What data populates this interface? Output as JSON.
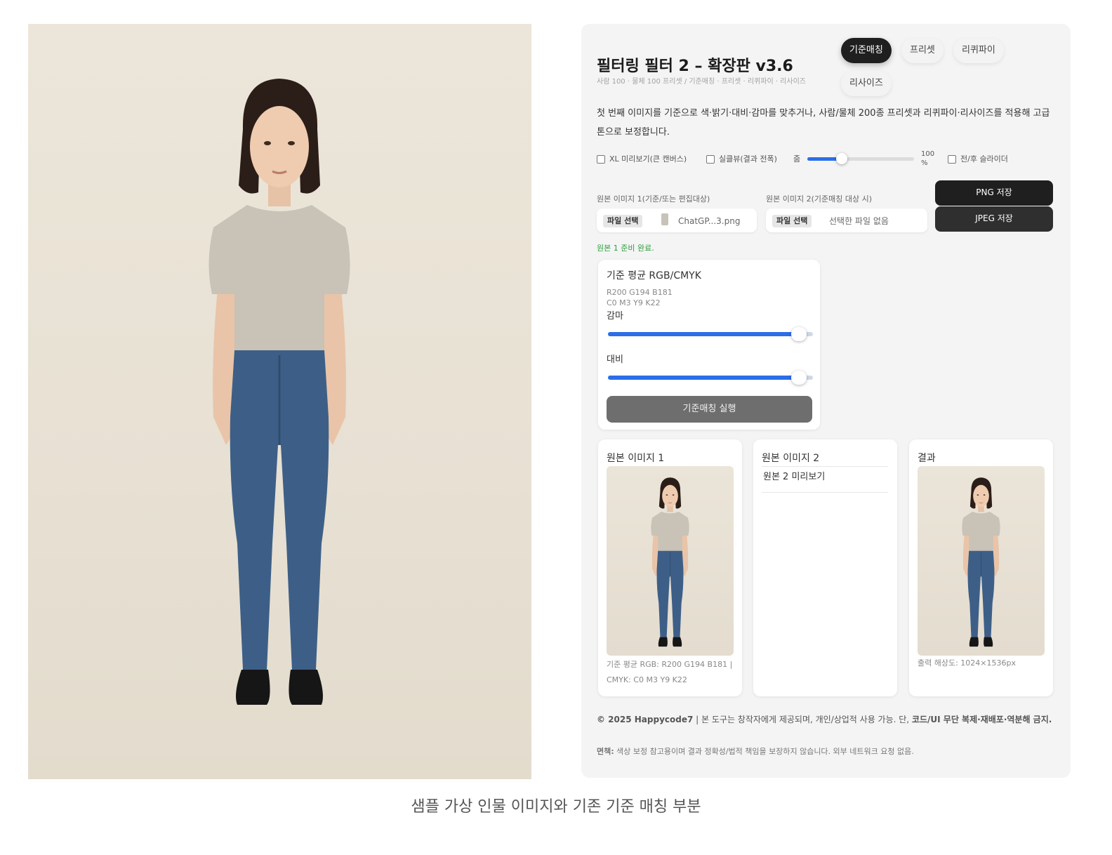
{
  "app": {
    "title": "필터링 필터 2 – 확장판 v3.6",
    "subtitle": "사람 100 · 물체 100 프리셋 / 기준매칭 · 프리셋 · 리퀴파이 · 리사이즈",
    "description": "첫 번째 이미지를 기준으로 색·밝기·대비·감마를 맞추거나, 사람/물체 200종 프리셋과 리퀴파이·리사이즈를 적용해 고급 톤으로 보정합니다."
  },
  "tabs": [
    {
      "label": "기준매칭",
      "active": true
    },
    {
      "label": "프리셋",
      "active": false
    },
    {
      "label": "리퀴파이",
      "active": false
    },
    {
      "label": "리사이즈",
      "active": false
    }
  ],
  "options": {
    "xl_preview_label": "XL 미리보기(큰 캔버스)",
    "realtime_label": "실클뷰(결과 전폭)",
    "zoom_label": "줌",
    "zoom_value": "100",
    "zoom_unit": "%",
    "zoom_fraction": 0.32,
    "before_after_label": "전/후 슬라이더"
  },
  "files": {
    "src1_label": "원본 이미지 1(기준/또는 편집대상)",
    "src2_label": "원본 이미지 2(기준매칭 대상 시)",
    "choose_label": "파일 선택",
    "src1_name": "ChatGP...3.png",
    "src2_name": "선택한 파일 없음",
    "png_save": "PNG 저장",
    "jpeg_save": "JPEG 저장",
    "status": "원본 1 준비 완료."
  },
  "match_panel": {
    "title": "기준 평균 RGB/CMYK",
    "rgb": "R200 G194 B181",
    "cmyk": "C0 M3 Y9 K22",
    "gamma_label": "감마",
    "gamma_fraction": 0.93,
    "contrast_label": "대비",
    "contrast_fraction": 0.93,
    "run_button": "기준매칭 실행"
  },
  "previews": {
    "card1_title": "원본 이미지 1",
    "card1_caption": "기준 평균 RGB: R200 G194 B181 | CMYK: C0 M3 Y9 K22",
    "card2_title": "원본 이미지 2",
    "card2_placeholder": "원본 2 미리보기",
    "card3_title": "결과",
    "card3_caption": "출력 해상도: 1024×1536px"
  },
  "footer": {
    "copyright_bold": "© 2025 Happycode7",
    "copyright_text": " | 본 도구는 창작자에게 제공되며, 개인/상업적 사용 가능. 단, ",
    "copyright_bold2": "코드/UI 무단 복제·재배포·역분해 금지.",
    "disclaimer_bold": "면책:",
    "disclaimer_text": " 색상 보정 참고용이며 결과 정확성/법적 책임을 보장하지 않습니다. 외부 네트워크 요청 없음."
  },
  "page_caption": "샘플 가상 인물 이미지와 기존 기준 매칭 부분",
  "colors": {
    "accent_blue": "#2b6ee8",
    "tab_active": "#1f1f1f",
    "status_green": "#2e9e3c",
    "panel_bg": "#f4f4f5"
  }
}
